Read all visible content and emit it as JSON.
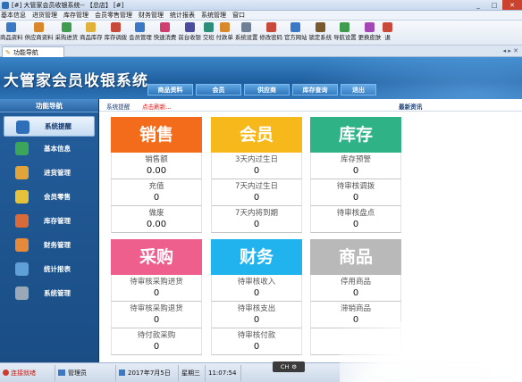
{
  "window": {
    "title": "[#] 大管家会员收银系统-- 【总店】 [#]",
    "buttons": [
      "_",
      "□",
      "✕"
    ]
  },
  "menu": [
    "基本信息",
    "进货管理",
    "库存管理",
    "会员零售管理",
    "财务管理",
    "统计报表",
    "系统管理",
    "窗口"
  ],
  "toolbar": [
    {
      "label": "商品资料",
      "icon": "product-icon",
      "color": "#3a79c4"
    },
    {
      "label": "供应商资料",
      "icon": "supplier-icon",
      "color": "#d9892b"
    },
    {
      "label": "采购进货",
      "icon": "purchase-icon",
      "color": "#3f9b4d"
    },
    {
      "label": "商品库存",
      "icon": "stock-icon",
      "color": "#e0b23a"
    },
    {
      "label": "库存调拨",
      "icon": "transfer-icon",
      "color": "#c84a3a"
    },
    {
      "label": "会员管理",
      "icon": "member-icon",
      "color": "#3a79c4"
    },
    {
      "label": "快速消费",
      "icon": "quick-pay-icon",
      "color": "#d23c6f"
    },
    {
      "label": "前台收银",
      "icon": "cashier-icon",
      "color": "#4c4c9e"
    },
    {
      "label": "交班",
      "icon": "handover-icon",
      "color": "#2d8f7b"
    },
    {
      "label": "付款单",
      "icon": "payment-icon",
      "color": "#d9892b"
    },
    {
      "label": "系统设置",
      "icon": "settings-icon",
      "color": "#6f7f94"
    },
    {
      "label": "修改密码",
      "icon": "password-icon",
      "color": "#c84a3a"
    },
    {
      "label": "官方网站",
      "icon": "website-icon",
      "color": "#3a79c4"
    },
    {
      "label": "锁定系统",
      "icon": "lock-icon",
      "color": "#7a5a2c"
    },
    {
      "label": "导航设置",
      "icon": "nav-settings-icon",
      "color": "#3f9b4d"
    },
    {
      "label": "更换皮肤",
      "icon": "skin-icon",
      "color": "#a447b6"
    },
    {
      "label": "退",
      "icon": "exit-icon",
      "color": "#c84a3a"
    }
  ],
  "doc_tab": {
    "label": "功能导航"
  },
  "header": {
    "title": "大管家会员收银系统",
    "nav": [
      "商品资料",
      "会员",
      "供应商",
      "库存查询",
      "退出"
    ]
  },
  "sidebar": {
    "title": "功能导航",
    "items": [
      {
        "label": "系统提醒",
        "icon": "info-icon",
        "color": "#2f6eb8"
      },
      {
        "label": "基本信息",
        "icon": "books-icon",
        "color": "#3aa55b"
      },
      {
        "label": "进货管理",
        "icon": "box-icon",
        "color": "#e1a43a"
      },
      {
        "label": "会员零售",
        "icon": "member-icon",
        "color": "#e6c23a"
      },
      {
        "label": "库存管理",
        "icon": "warehouse-icon",
        "color": "#d96a3a"
      },
      {
        "label": "财务管理",
        "icon": "finance-icon",
        "color": "#e58a3a"
      },
      {
        "label": "统计报表",
        "icon": "report-icon",
        "color": "#5fa0d8"
      },
      {
        "label": "系统管理",
        "icon": "gears-icon",
        "color": "#9aa8b8"
      }
    ]
  },
  "infobar": {
    "left": "系统提醒",
    "refresh": "点击刷新...",
    "right": "最新资讯"
  },
  "cards": [
    {
      "title": "销售",
      "color": "#f26c1c",
      "rows": [
        {
          "k": "销售额",
          "v": "0.00"
        },
        {
          "k": "充值",
          "v": "0"
        },
        {
          "k": "做废",
          "v": "0.00"
        }
      ]
    },
    {
      "title": "会员",
      "color": "#f7b81b",
      "rows": [
        {
          "k": "3天内过生日",
          "v": "0"
        },
        {
          "k": "7天内过生日",
          "v": "0"
        },
        {
          "k": "7天内将到期",
          "v": "0"
        }
      ]
    },
    {
      "title": "库存",
      "color": "#2fb286",
      "rows": [
        {
          "k": "库存预警",
          "v": "0"
        },
        {
          "k": "待审核调拨",
          "v": "0"
        },
        {
          "k": "待审核盘点",
          "v": "0"
        }
      ]
    },
    {
      "title": "采购",
      "color": "#ef5f8e",
      "rows": [
        {
          "k": "待审核采购进货",
          "v": "0"
        },
        {
          "k": "待审核采购退货",
          "v": "0"
        },
        {
          "k": "待付款采购",
          "v": "0"
        }
      ]
    },
    {
      "title": "财务",
      "color": "#21b3ee",
      "rows": [
        {
          "k": "待审核收入",
          "v": "0"
        },
        {
          "k": "待审核支出",
          "v": "0"
        },
        {
          "k": "待审核付款",
          "v": "0"
        }
      ]
    },
    {
      "title": "商品",
      "color": "#b9b9b9",
      "rows": [
        {
          "k": "停用商品",
          "v": "0"
        },
        {
          "k": "滞销商品",
          "v": "0"
        },
        {
          "k": "",
          "v": ""
        }
      ]
    }
  ],
  "statusbar": {
    "connection": "连接就绪",
    "user": "管理员",
    "date": "2017年7月5日",
    "weekday": "星期三",
    "time": "11:07:54",
    "ime": "CH"
  }
}
